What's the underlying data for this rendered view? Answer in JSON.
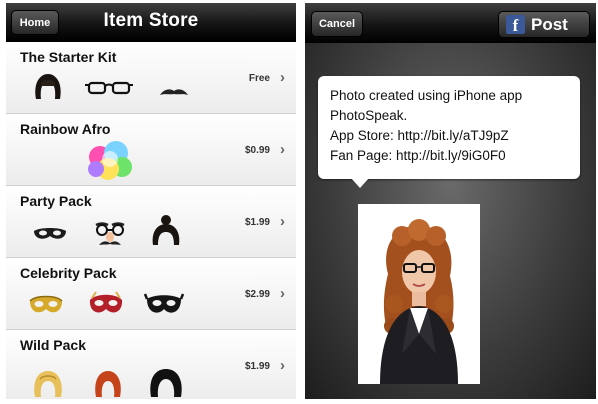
{
  "store": {
    "home_label": "Home",
    "title": "Item Store",
    "items": [
      {
        "title": "The Starter Kit",
        "price": "Free",
        "thumbs": [
          "bob-wig-icon",
          "glasses-icon",
          "mustache-icon"
        ]
      },
      {
        "title": "Rainbow Afro",
        "price": "$0.99",
        "thumbs": [
          "rainbow-afro-icon"
        ]
      },
      {
        "title": "Party Pack",
        "price": "$1.99",
        "thumbs": [
          "eye-mask-icon",
          "groucho-glasses-icon",
          "bun-wig-icon"
        ]
      },
      {
        "title": "Celebrity Pack",
        "price": "$2.99",
        "thumbs": [
          "gold-mask-icon",
          "red-mask-icon",
          "black-mask-icon"
        ]
      },
      {
        "title": "Wild Pack",
        "price": "$1.99",
        "thumbs": [
          "blonde-wig-icon",
          "red-wig-icon",
          "black-wig-icon"
        ]
      }
    ]
  },
  "post": {
    "cancel_label": "Cancel",
    "post_label": "Post",
    "fb_letter": "f",
    "message": {
      "line1": "Photo created using iPhone app",
      "line2": "PhotoSpeak.",
      "line3": "App Store: http://bit.ly/aTJ9pZ",
      "line4": "Fan Page: http://bit.ly/9iG0F0"
    },
    "photo_icon": "portrait-photo-icon"
  },
  "colors": {
    "header_dark": "#141414",
    "facebook_blue": "#3b5998",
    "row_border": "#cfcfcf"
  }
}
